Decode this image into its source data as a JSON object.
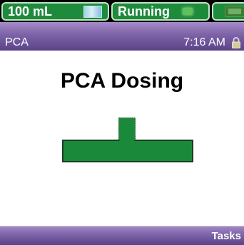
{
  "status_bar": {
    "volume": "100 mL",
    "pump_state": "Running"
  },
  "title_bar": {
    "channel": "PCA",
    "time": "7:16 AM"
  },
  "main": {
    "heading": "PCA Dosing"
  },
  "soft_keys": {
    "tasks": "Tasks"
  },
  "colors": {
    "status_green": "#1e8a3c",
    "title_purple": "#7c62a6",
    "dose_green": "#1a8a3a"
  },
  "icons": [
    "syringe-icon",
    "run-indicator-icon",
    "battery-icon",
    "lock-icon",
    "dose-bar-graphic"
  ]
}
